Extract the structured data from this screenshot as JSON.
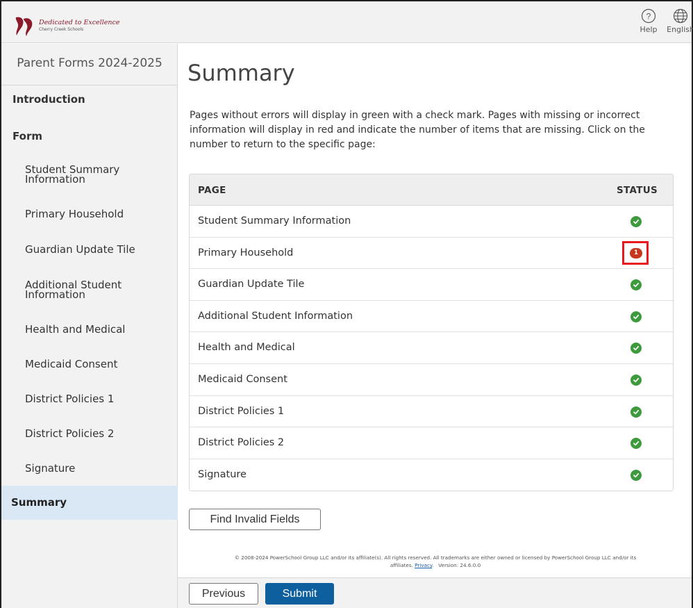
{
  "header": {
    "logo_line1": "Dedicated to Excellence",
    "logo_line2": "Cherry Creek Schools",
    "help_label": "Help",
    "language_label": "English"
  },
  "sidebar": {
    "title": "Parent Forms 2024-2025",
    "sections": [
      {
        "label": "Introduction"
      },
      {
        "label": "Form"
      }
    ],
    "items": [
      {
        "label": "Student Summary Information"
      },
      {
        "label": "Primary Household"
      },
      {
        "label": "Guardian Update Tile"
      },
      {
        "label": "Additional Student Information"
      },
      {
        "label": "Health and Medical"
      },
      {
        "label": "Medicaid Consent"
      },
      {
        "label": "District Policies 1"
      },
      {
        "label": "District Policies 2"
      },
      {
        "label": "Signature"
      }
    ],
    "active": "Summary"
  },
  "main": {
    "title": "Summary",
    "intro": "Pages without errors will display in green with a check mark. Pages with missing or incorrect information will display in red and indicate the number of items that are missing. Click on the number to return to the specific page:",
    "table": {
      "col_page": "PAGE",
      "col_status": "STATUS",
      "rows": [
        {
          "page": "Student Summary Information",
          "status": "ok",
          "count": ""
        },
        {
          "page": "Primary Household",
          "status": "error",
          "count": "1"
        },
        {
          "page": "Guardian Update Tile",
          "status": "ok",
          "count": ""
        },
        {
          "page": "Additional Student Information",
          "status": "ok",
          "count": ""
        },
        {
          "page": "Health and Medical",
          "status": "ok",
          "count": ""
        },
        {
          "page": "Medicaid Consent",
          "status": "ok",
          "count": ""
        },
        {
          "page": "District Policies 1",
          "status": "ok",
          "count": ""
        },
        {
          "page": "District Policies 2",
          "status": "ok",
          "count": ""
        },
        {
          "page": "Signature",
          "status": "ok",
          "count": ""
        }
      ]
    },
    "find_invalid_label": "Find Invalid Fields"
  },
  "footer": {
    "copyright_line1": "© 2008-2024 PowerSchool Group LLC and/or its affiliate(s). All rights reserved. All trademarks are either owned or licensed by PowerSchool Group LLC and/or its",
    "copyright_line2_prefix": "affiliates.",
    "privacy_link": "Privacy",
    "version": "Version: 24.6.0.0",
    "previous_label": "Previous",
    "submit_label": "Submit"
  },
  "colors": {
    "ok": "#3d9a3d",
    "error": "#c8361b",
    "highlight_box": "#e8191f",
    "primary": "#0d5f9e",
    "active_nav": "#d9e8f4"
  }
}
